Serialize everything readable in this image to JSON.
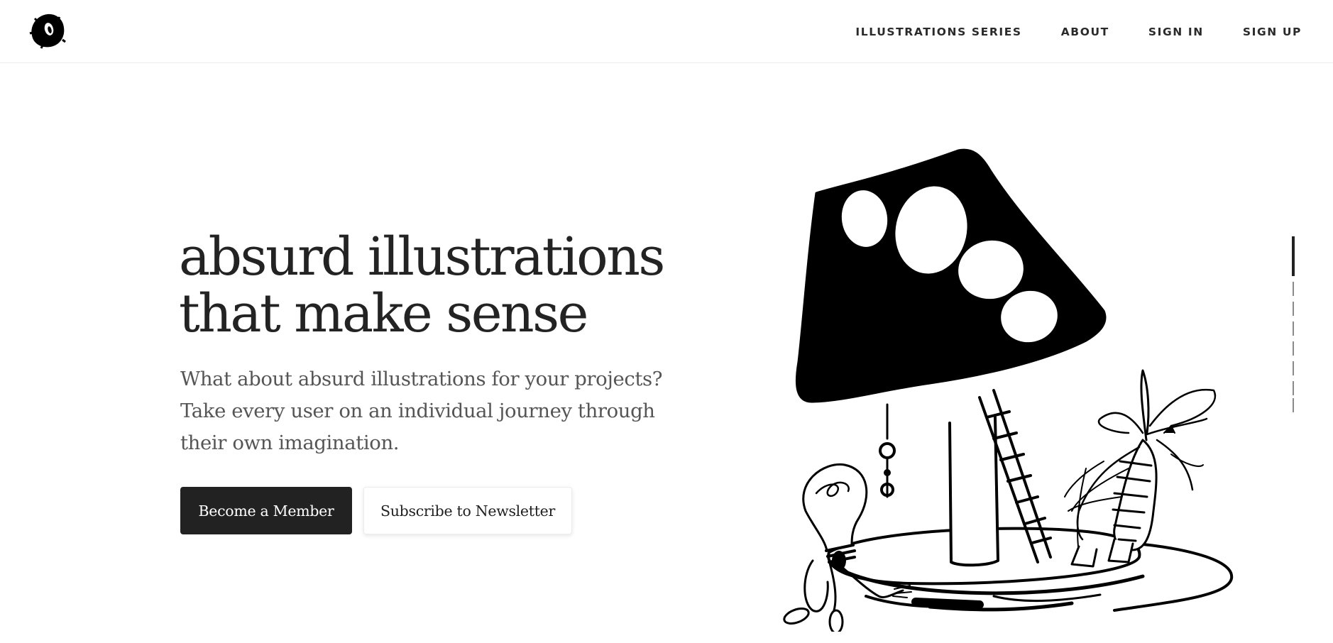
{
  "header": {
    "logo_icon": "blob-logo-icon",
    "nav": [
      {
        "label": "ILLUSTRATIONS SERIES"
      },
      {
        "label": "ABOUT"
      },
      {
        "label": "SIGN IN"
      },
      {
        "label": "SIGN UP"
      }
    ]
  },
  "hero": {
    "title_lines": [
      "absurd illustrations",
      "that make sense"
    ],
    "subtitle_lines": [
      "What about absurd illustrations for your projects?",
      "Take every user on an individual journey through",
      "their own imagination."
    ],
    "primary_button": "Become a Member",
    "secondary_button": "Subscribe to Newsletter"
  },
  "illustration": {
    "icon": "mushroom-lamp-illustration",
    "description_name": "lamp-with-ladder-lightbulb-and-plant"
  },
  "scroll_indicator": {
    "icon": "scroll-progress-indicator",
    "total_steps": 7,
    "active_step": 1
  },
  "colors": {
    "text_dark": "#232323",
    "text_muted": "#555555",
    "button_primary_bg": "#222222",
    "background": "#ffffff"
  }
}
